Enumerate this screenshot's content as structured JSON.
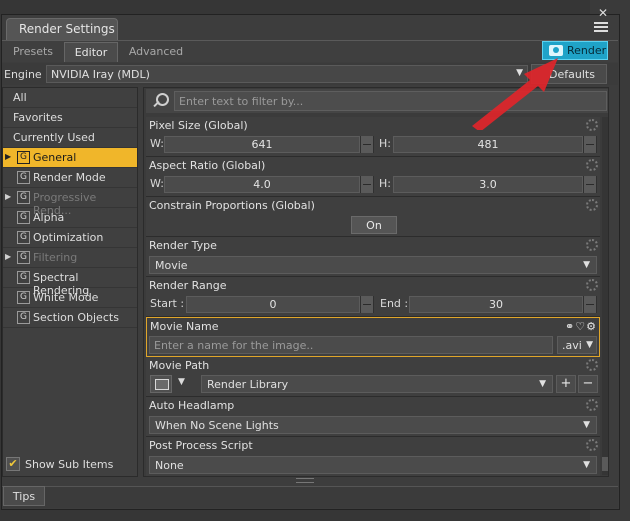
{
  "window": {
    "title": "Render Settings",
    "close_glyph": "✕"
  },
  "tabs": [
    {
      "label": "Presets",
      "active": false
    },
    {
      "label": "Editor",
      "active": true
    },
    {
      "label": "Advanced",
      "active": false
    }
  ],
  "render_button": {
    "label": "Render",
    "icon": "camera-icon",
    "color": "#1fa3c8"
  },
  "engine": {
    "label": "Engine :",
    "value": "NVIDIA Iray (MDL)",
    "defaults_label": "Defaults"
  },
  "sidebar": {
    "items": [
      {
        "label": "All"
      },
      {
        "label": "Favorites"
      },
      {
        "label": "Currently Used"
      },
      {
        "label": "General",
        "badge": "G",
        "expandable": true,
        "selected": true
      },
      {
        "label": "Render Mode",
        "badge": "G"
      },
      {
        "label": "Progressive Rend...",
        "badge": "G",
        "expandable": true,
        "disabled": true
      },
      {
        "label": "Alpha",
        "badge": "G"
      },
      {
        "label": "Optimization",
        "badge": "G"
      },
      {
        "label": "Filtering",
        "badge": "G",
        "expandable": true,
        "disabled": true
      },
      {
        "label": "Spectral Rendering",
        "badge": "G"
      },
      {
        "label": "White Mode",
        "badge": "G"
      },
      {
        "label": "Section Objects",
        "badge": "G"
      }
    ],
    "show_sub_items": {
      "label": "Show Sub Items",
      "checked": true
    }
  },
  "filter": {
    "placeholder": "Enter text to filter by..."
  },
  "properties": {
    "pixel_size": {
      "title": "Pixel Size (Global)",
      "w_label": "W:",
      "w_value": "641",
      "h_label": "H:",
      "h_value": "481"
    },
    "aspect_ratio": {
      "title": "Aspect Ratio (Global)",
      "w_label": "W:",
      "w_value": "4.0",
      "h_label": "H:",
      "h_value": "3.0"
    },
    "constrain": {
      "title": "Constrain Proportions (Global)",
      "value": "On"
    },
    "render_type": {
      "title": "Render Type",
      "value": "Movie"
    },
    "render_range": {
      "title": "Render Range",
      "start_label": "Start :",
      "start_value": "0",
      "end_label": "End :",
      "end_value": "30"
    },
    "movie_name": {
      "title": "Movie Name",
      "placeholder": "Enter a name for the image..",
      "extension": ".avi"
    },
    "movie_path": {
      "title": "Movie Path",
      "value": "Render Library",
      "add": "+",
      "remove": "−"
    },
    "auto_headlamp": {
      "title": "Auto Headlamp",
      "value": "When No Scene Lights"
    },
    "post_process": {
      "title": "Post Process Script",
      "value": "None"
    }
  },
  "footer": {
    "tips_label": "Tips"
  },
  "colors": {
    "accent": "#f0b62a",
    "render": "#1fa3c8",
    "annotation_arrow": "#e0252a"
  }
}
